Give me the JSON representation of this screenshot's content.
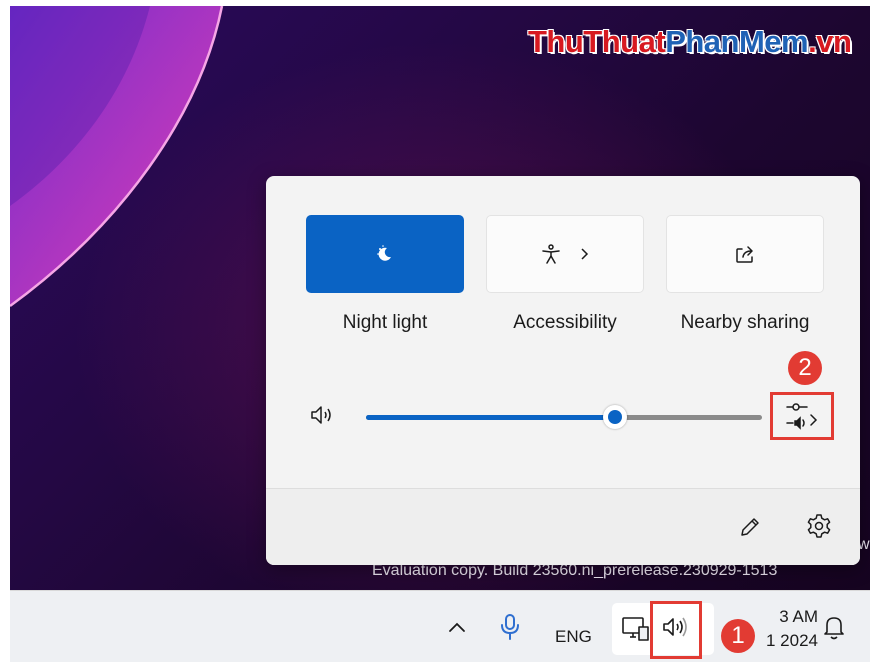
{
  "watermark": {
    "part1": "ThuThuat",
    "part2": "PhanMem",
    "part3": ".vn"
  },
  "desktop": {
    "evaluation_text": "Evaluation copy. Build 23560.ni_prerelease.230929-1513",
    "evaluation_side_text": "w"
  },
  "quick_settings": {
    "tiles": [
      {
        "label": "Night light",
        "icon": "night-light-icon",
        "active": true
      },
      {
        "label": "Accessibility",
        "icon": "accessibility-icon",
        "has_chevron": true
      },
      {
        "label": "Nearby sharing",
        "icon": "share-icon"
      }
    ],
    "volume": {
      "level_percent": 63,
      "output_icon": "sound-output-icon"
    },
    "footer": {
      "edit_icon": "pencil-icon",
      "settings_icon": "gear-icon"
    }
  },
  "annotations": {
    "step1": "1",
    "step2": "2"
  },
  "taskbar": {
    "language": "ENG",
    "clock_time": "3 AM",
    "clock_date": "1 2024"
  },
  "colors": {
    "accent": "#0a63c4",
    "annotation_red": "#e23b33"
  }
}
